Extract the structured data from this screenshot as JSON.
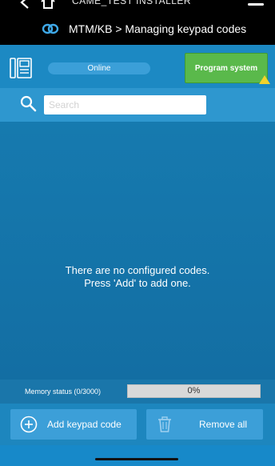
{
  "header": {
    "installer": "CAME_TEST INSTALLER",
    "breadcrumb": "MTM/KB > Managing keypad codes"
  },
  "toolbar": {
    "status": "Online",
    "program_label": "Program system"
  },
  "search": {
    "placeholder": "Search",
    "value": ""
  },
  "main": {
    "empty_line1": "There are no configured codes.",
    "empty_line2": "Press 'Add' to add one."
  },
  "memory": {
    "label": "Memory status (0/3000)",
    "percent_text": "0%",
    "fraction": 0
  },
  "actions": {
    "add_label": "Add keypad code",
    "remove_label": "Remove all"
  },
  "colors": {
    "accent": "#1c89c3",
    "program_green": "#5ab94b",
    "warning": "#f1d22c"
  }
}
